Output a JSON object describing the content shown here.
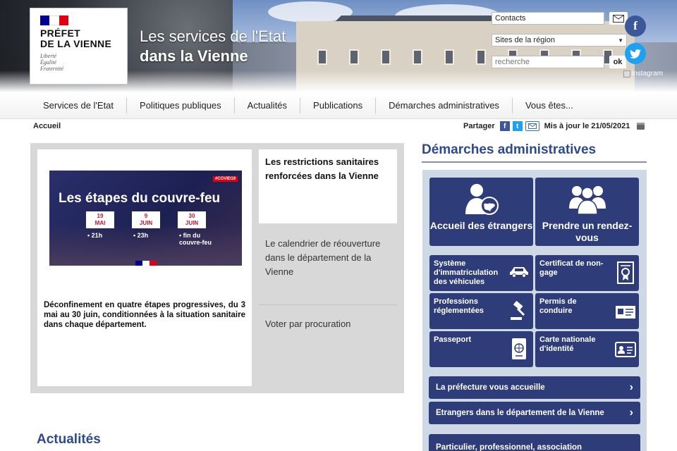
{
  "header": {
    "logo": {
      "title_line1": "PRÉFET",
      "title_line2": "DE LA VIENNE",
      "motto_line1": "Liberté",
      "motto_line2": "Égalité",
      "motto_line3": "Fraternité"
    },
    "site_title_line1": "Les services de l'Etat",
    "site_title_line2": "dans la Vienne",
    "contacts_label": "Contacts",
    "sites_select_value": "Sites de la région",
    "search_placeholder": "recherche",
    "search_button": "ok",
    "instagram_label": "instagram",
    "colors": {
      "flag_blue": "#000091",
      "flag_red": "#e1000f",
      "facebook": "#3b5998",
      "twitter": "#1da1f2"
    }
  },
  "nav": {
    "items": [
      {
        "label": "Services de l'Etat"
      },
      {
        "label": "Politiques publiques"
      },
      {
        "label": "Actualités"
      },
      {
        "label": "Publications"
      },
      {
        "label": "Démarches administratives"
      },
      {
        "label": "Vous êtes..."
      }
    ]
  },
  "breadcrumb": {
    "current": "Accueil"
  },
  "share": {
    "label": "Partager",
    "updated": "Mis à jour le 21/05/2021"
  },
  "carousel": {
    "image": {
      "tag": "#COVID19",
      "title": "Les étapes du couvre-feu",
      "dates": [
        {
          "line1": "19",
          "line2": "MAI",
          "caption": "• 21h"
        },
        {
          "line1": "9",
          "line2": "JUIN",
          "caption": "• 23h"
        },
        {
          "line1": "30",
          "line2": "JUIN",
          "caption": "• fin du couvre-feu"
        }
      ]
    },
    "caption": "Déconfinement en quatre étapes progressives, du 3 mai au 30 juin, conditionnées à la situation sanitaire dans chaque département.",
    "tabs": [
      {
        "label": "Les restrictions sanitaires renforcées dans la Vienne",
        "active": true
      },
      {
        "label": "Le calendrier de réouverture dans le département de la Vienne",
        "active": false
      },
      {
        "label": "Voter par procuration",
        "active": false
      }
    ]
  },
  "demarches": {
    "title": "Démarches administratives",
    "big_tiles": [
      {
        "label": "Accueil des étrangers",
        "icon": "person-globe-icon"
      },
      {
        "label": "Prendre un rendez-vous",
        "icon": "people-group-icon"
      }
    ],
    "small_tiles": [
      {
        "label": "Système d'immatriculation des véhicules",
        "icon": "car-icon"
      },
      {
        "label": "Certificat de non-gage",
        "icon": "certificate-icon"
      },
      {
        "label": "Professions réglementées",
        "icon": "gavel-icon"
      },
      {
        "label": "Permis de conduire",
        "icon": "license-card-icon"
      },
      {
        "label": "Passeport",
        "icon": "passport-icon"
      },
      {
        "label": "Carte nationale d'identité",
        "icon": "id-card-icon"
      }
    ],
    "links": [
      {
        "label": "La préfecture vous accueille"
      },
      {
        "label": "Etrangers dans le département de la Vienne"
      },
      {
        "label": "Particulier, professionnel, association"
      }
    ],
    "colors": {
      "tile": "#2e3d7a",
      "title": "#2d4a8a",
      "panel": "#cfd9e6"
    }
  },
  "actualites": {
    "title": "Actualités"
  }
}
